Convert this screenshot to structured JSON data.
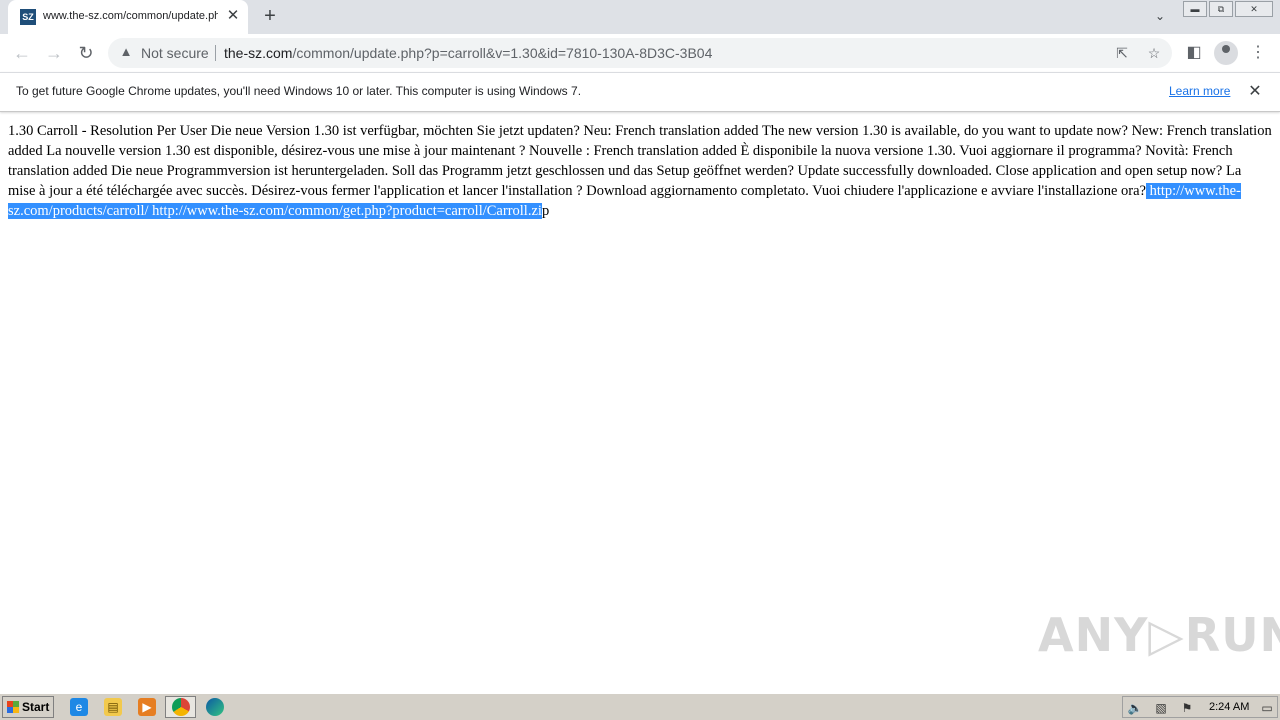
{
  "browser": {
    "tab_title": "www.the-sz.com/common/update.php",
    "favicon_text": "SZ",
    "new_tab": "+",
    "tab_close": "✕",
    "not_secure": "Not secure",
    "url_host": "the-sz.com",
    "url_path": "/common/update.php?p=carroll&v=1.30&id=7810-130A-8D3C-3B04",
    "icons": [
      "back-icon",
      "forward-icon",
      "reload-icon",
      "warning-icon",
      "share-icon",
      "star-icon",
      "side-panel-icon",
      "profile-icon",
      "menu-icon",
      "tab-search-icon",
      "minimize-icon",
      "restore-icon",
      "close-icon"
    ]
  },
  "infobar": {
    "text": "To get future Google Chrome updates, you'll need Windows 10 or later. This computer is using Windows 7.",
    "link": "Learn more",
    "close": "✕"
  },
  "page": {
    "text_before": "1.30 Carroll - Resolution Per User Die neue Version 1.30 ist verfügbar, möchten Sie jetzt updaten? Neu: French translation added The new version 1.30 is available, do you want to update now? New: French translation added La nouvelle version 1.30 est disponible, désirez-vous une mise à jour maintenant ? Nouvelle : French translation added È disponibile la nuova versione 1.30. Vuoi aggiornare il programma? Novità: French translation added Die neue Programmversion ist heruntergeladen. Soll das Programm jetzt geschlossen und das Setup geöffnet werden? Update successfully downloaded. Close application and open setup now? La mise à jour a été téléchargée avec succès. Désirez-vous fermer l'application et lancer l'installation ? Download aggiornamento completato. Vuoi chiudere l'applicazione e avviare l'installazione ora?",
    "text_selected": " http://www.the-sz.com/products/carroll/ http://www.the-sz.com/common/get.php?product=carroll/Carroll.zi",
    "text_after": "p"
  },
  "watermark": "ANY RUN",
  "taskbar": {
    "start": "Start",
    "clock": "2:24 AM",
    "icons": [
      "internet-explorer-icon",
      "explorer-icon",
      "media-player-icon",
      "chrome-icon",
      "edge-icon"
    ]
  },
  "colors": {
    "selection": "#3390ff",
    "link": "#1a73e8",
    "taskbar": "#d4d0c8"
  }
}
